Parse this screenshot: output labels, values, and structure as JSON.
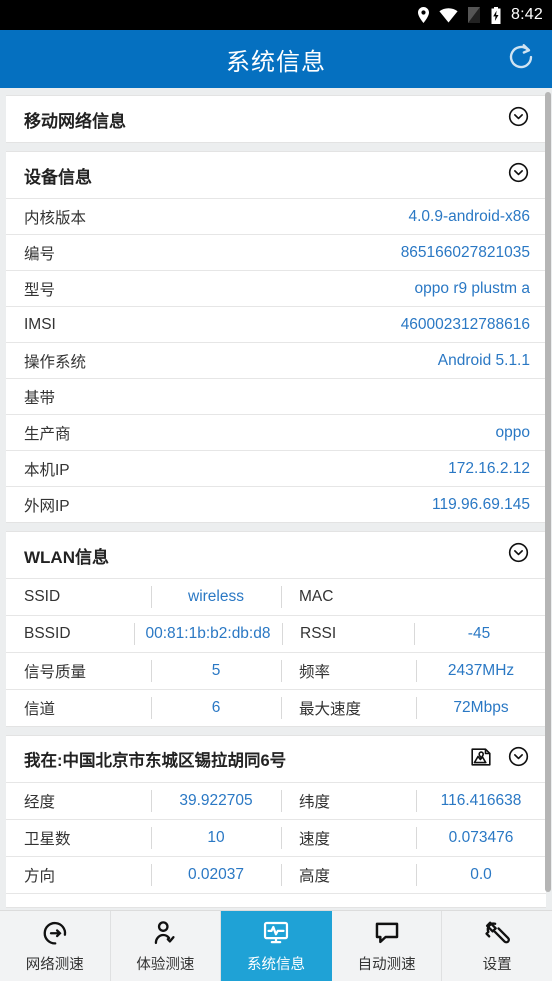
{
  "statusbar": {
    "time": "8:42",
    "icons": [
      "location-icon",
      "wifi-icon",
      "sim-icon",
      "battery-charging-icon"
    ]
  },
  "appbar": {
    "title": "系统信息",
    "refresh_label": "refresh-icon",
    "background": "#0570c0"
  },
  "colors": {
    "header_blue": "#0570c0",
    "link_blue": "#2a78c4",
    "active_tab": "#1fa2d6",
    "page_bg": "#eceeef"
  },
  "sections": {
    "mobile_network": {
      "title": "移动网络信息",
      "expand_icon": "chevron-down-circle-icon"
    },
    "device": {
      "title": "设备信息",
      "expand_icon": "chevron-down-circle-icon",
      "rows": [
        {
          "key": "内核版本",
          "value": "4.0.9-android-x86"
        },
        {
          "key": "编号",
          "value": "865166027821035"
        },
        {
          "key": "型号",
          "value": "oppo r9 plustm a"
        },
        {
          "key": "IMSI",
          "value": "460002312788616"
        },
        {
          "key": "操作系统",
          "value": "Android 5.1.1"
        },
        {
          "key": "基带",
          "value": ""
        },
        {
          "key": "生产商",
          "value": "oppo"
        },
        {
          "key": "本机IP",
          "value": "172.16.2.12"
        },
        {
          "key": "外网IP",
          "value": "119.96.69.145"
        }
      ]
    },
    "wlan": {
      "title": "WLAN信息",
      "expand_icon": "chevron-down-circle-icon",
      "rows": [
        {
          "k1": "SSID",
          "v1": "wireless",
          "k2": "MAC",
          "v2": ""
        },
        {
          "k1": "BSSID",
          "v1": "00:81:1b:b2:db:d8",
          "k2": "RSSI",
          "v2": "-45"
        },
        {
          "k1": "信号质量",
          "v1": "5",
          "k2": "频率",
          "v2": "2437MHz"
        },
        {
          "k1": "信道",
          "v1": "6",
          "k2": "最大速度",
          "v2": "72Mbps"
        }
      ]
    },
    "location": {
      "title": "我在:中国北京市东城区锡拉胡同6号",
      "map_icon": "map-pin-icon",
      "expand_icon": "chevron-down-circle-icon",
      "rows": [
        {
          "k1": "经度",
          "v1": "39.922705",
          "k2": "纬度",
          "v2": "116.416638"
        },
        {
          "k1": "卫星数",
          "v1": "10",
          "k2": "速度",
          "v2": "0.073476"
        },
        {
          "k1": "方向",
          "v1": "0.02037",
          "k2": "高度",
          "v2": "0.0"
        }
      ]
    }
  },
  "bottomnav": {
    "items": [
      {
        "label": "网络测速",
        "icon": "speedometer-icon",
        "active": false
      },
      {
        "label": "体验测速",
        "icon": "user-check-icon",
        "active": false
      },
      {
        "label": "系统信息",
        "icon": "monitor-pulse-icon",
        "active": true
      },
      {
        "label": "自动测速",
        "icon": "chat-bubble-icon",
        "active": false
      },
      {
        "label": "设置",
        "icon": "wrench-icon",
        "active": false
      }
    ]
  }
}
